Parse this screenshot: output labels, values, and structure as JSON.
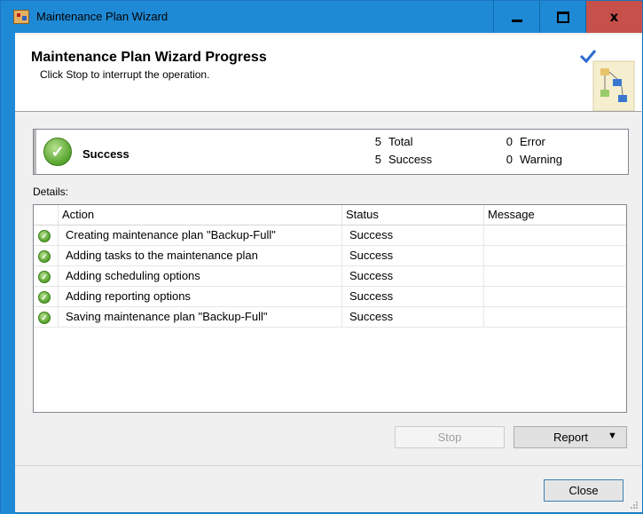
{
  "window": {
    "title": "Maintenance Plan Wizard",
    "icon": "maintenance-plan-icon",
    "controls": {
      "minimize": "minimize-icon",
      "maximize": "maximize-icon",
      "close_label": "x"
    }
  },
  "header": {
    "title": "Maintenance Plan Wizard Progress",
    "subtitle": "Click Stop to interrupt the operation."
  },
  "summary": {
    "status_label": "Success",
    "total_count": "5",
    "total_label": "Total",
    "success_count": "5",
    "success_label": "Success",
    "error_count": "0",
    "error_label": "Error",
    "warning_count": "0",
    "warning_label": "Warning"
  },
  "details": {
    "label": "Details:",
    "columns": [
      "Action",
      "Status",
      "Message"
    ],
    "rows": [
      {
        "action": "Creating maintenance plan \"Backup-Full\"",
        "status": "Success",
        "message": ""
      },
      {
        "action": "Adding tasks to the maintenance plan",
        "status": "Success",
        "message": ""
      },
      {
        "action": "Adding scheduling options",
        "status": "Success",
        "message": ""
      },
      {
        "action": "Adding reporting options",
        "status": "Success",
        "message": ""
      },
      {
        "action": "Saving maintenance plan \"Backup-Full\"",
        "status": "Success",
        "message": ""
      }
    ]
  },
  "buttons": {
    "stop": "Stop",
    "report": "Report",
    "close": "Close"
  },
  "colors": {
    "titlebar": "#1e8ad6",
    "close_button": "#c7504a",
    "success_green": "#55a32c"
  }
}
